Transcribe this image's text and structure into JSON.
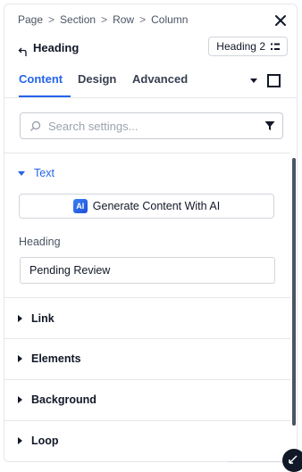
{
  "breadcrumb": [
    "Page",
    "Section",
    "Row",
    "Column"
  ],
  "header": {
    "title": "Heading",
    "tag_select": "Heading 2"
  },
  "tabs": [
    "Content",
    "Design",
    "Advanced"
  ],
  "search": {
    "placeholder": "Search settings..."
  },
  "sections": {
    "text": {
      "label": "Text",
      "ai_button": "Generate Content With AI",
      "field_label": "Heading",
      "field_value": "Pending Review"
    },
    "link": "Link",
    "elements": "Elements",
    "background": "Background",
    "loop": "Loop"
  },
  "colors": {
    "accent": "#2563eb",
    "text": "#111827",
    "border": "#e5e7eb"
  },
  "icons": [
    "close-icon",
    "back-arrow-icon",
    "tag-list-icon",
    "search-icon",
    "filter-icon",
    "ai-icon",
    "resize-icon"
  ]
}
